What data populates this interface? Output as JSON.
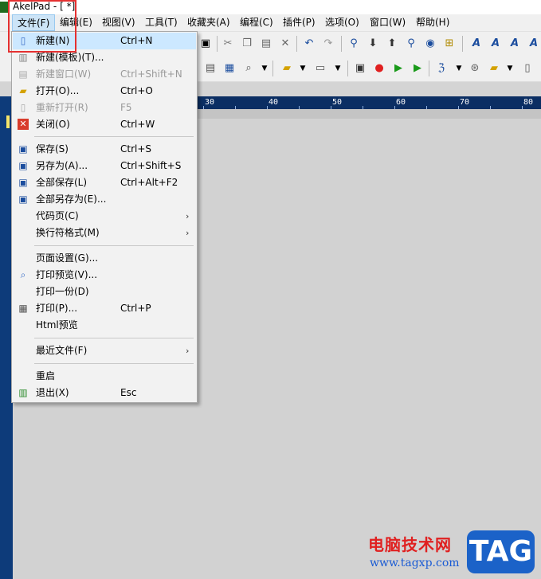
{
  "window": {
    "title": "AkelPad - [ *]"
  },
  "menubar": [
    {
      "label": "文件(F)",
      "active": true
    },
    {
      "label": "编辑(E)"
    },
    {
      "label": "视图(V)"
    },
    {
      "label": "工具(T)"
    },
    {
      "label": "收藏夹(A)"
    },
    {
      "label": "编程(C)"
    },
    {
      "label": "插件(P)"
    },
    {
      "label": "选项(O)"
    },
    {
      "label": "窗口(W)"
    },
    {
      "label": "帮助(H)"
    }
  ],
  "ruler": {
    "ticks": [
      "30",
      "40",
      "50",
      "60",
      "70",
      "80"
    ]
  },
  "file_menu": {
    "items": [
      {
        "label": "新建(N)",
        "shortcut": "Ctrl+N",
        "icon": "new-document-icon",
        "highlighted": true
      },
      {
        "label": "新建(模板)(T)...",
        "shortcut": "",
        "icon": "template-icon"
      },
      {
        "label": "新建窗口(W)",
        "shortcut": "Ctrl+Shift+N",
        "icon": "new-window-icon",
        "disabled": true
      },
      {
        "label": "打开(O)...",
        "shortcut": "Ctrl+O",
        "icon": "open-folder-icon"
      },
      {
        "label": "重新打开(R)",
        "shortcut": "F5",
        "icon": "reopen-icon",
        "disabled": true
      },
      {
        "label": "关闭(O)",
        "shortcut": "Ctrl+W",
        "icon": "close-icon"
      },
      {
        "label": "保存(S)",
        "shortcut": "Ctrl+S",
        "icon": "save-icon"
      },
      {
        "label": "另存为(A)...",
        "shortcut": "Ctrl+Shift+S",
        "icon": "save-as-icon"
      },
      {
        "label": "全部保存(L)",
        "shortcut": "Ctrl+Alt+F2",
        "icon": "save-all-icon"
      },
      {
        "label": "全部另存为(E)...",
        "shortcut": "",
        "icon": "save-all-as-icon"
      },
      {
        "label": "代码页(C)",
        "shortcut": "",
        "submenu": true
      },
      {
        "label": "换行符格式(M)",
        "shortcut": "",
        "submenu": true
      },
      {
        "label": "页面设置(G)...",
        "shortcut": ""
      },
      {
        "label": "打印预览(V)...",
        "shortcut": "",
        "icon": "print-preview-icon"
      },
      {
        "label": "打印一份(D)",
        "shortcut": ""
      },
      {
        "label": "打印(P)...",
        "shortcut": "Ctrl+P",
        "icon": "printer-icon"
      },
      {
        "label": "Html预览",
        "shortcut": ""
      },
      {
        "label": "最近文件(F)",
        "shortcut": "",
        "submenu": true
      },
      {
        "label": "重启",
        "shortcut": ""
      },
      {
        "label": "退出(X)",
        "shortcut": "Esc",
        "icon": "exit-icon"
      }
    ],
    "submenu_arrow": "›"
  },
  "watermark": {
    "site_name": "电脑技术网",
    "url": "www.tagxp.com",
    "badge": "TAG"
  },
  "colors": {
    "highlight": "#cce8ff",
    "ruler": "#0b2e63",
    "redbox": "#e53030"
  }
}
